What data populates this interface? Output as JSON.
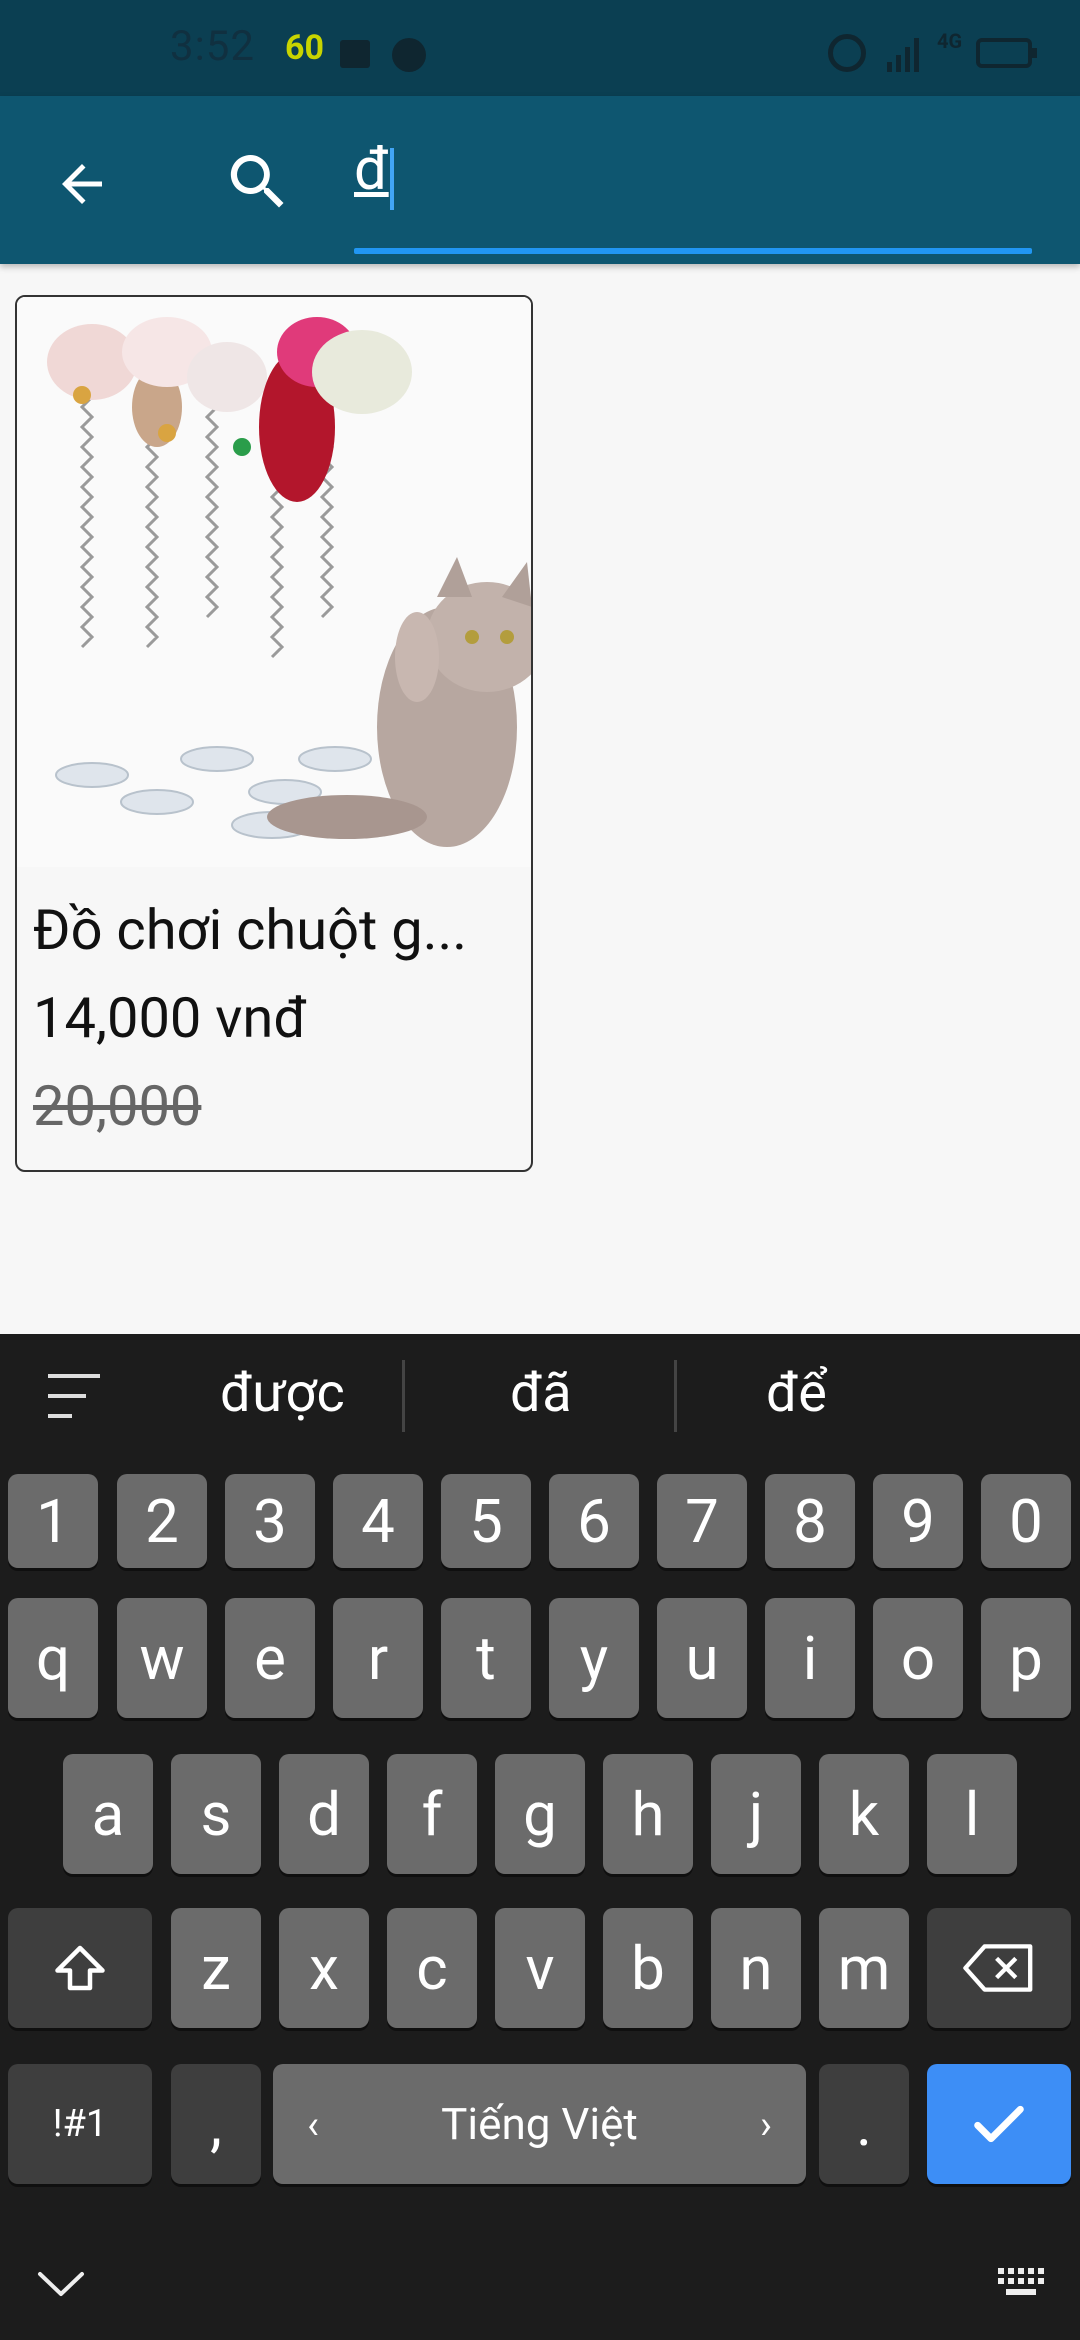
{
  "status_bar": {
    "time": "3:52",
    "signal_badge": "60",
    "network": "4G"
  },
  "search": {
    "query": "đ"
  },
  "results": [
    {
      "name": "Đồ chơi chuột g...",
      "price": "14,000 vnđ",
      "old_price": "20,000"
    }
  ],
  "keyboard": {
    "suggestions": [
      "được",
      "đã",
      "để"
    ],
    "row_numbers": [
      "1",
      "2",
      "3",
      "4",
      "5",
      "6",
      "7",
      "8",
      "9",
      "0"
    ],
    "row_q": [
      "q",
      "w",
      "e",
      "r",
      "t",
      "y",
      "u",
      "i",
      "o",
      "p"
    ],
    "row_a": [
      "a",
      "s",
      "d",
      "f",
      "g",
      "h",
      "j",
      "k",
      "l"
    ],
    "row_z": [
      "z",
      "x",
      "c",
      "v",
      "b",
      "n",
      "m"
    ],
    "symbols_label": "!#1",
    "comma": ",",
    "space_label": "Tiếng Việt",
    "period": "."
  }
}
